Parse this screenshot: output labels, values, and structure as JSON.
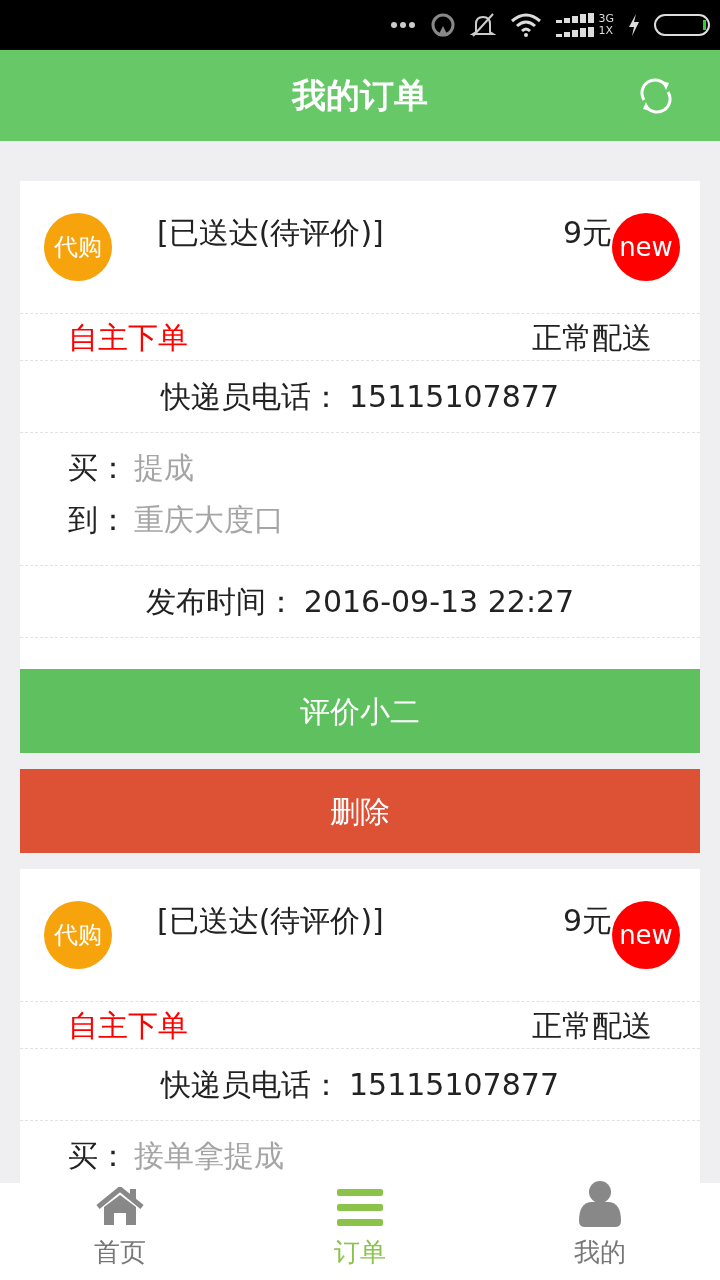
{
  "status_bar": {
    "network_top": "3G",
    "network_bottom": "1X"
  },
  "header": {
    "title": "我的订单"
  },
  "orders": [
    {
      "badge": "代购",
      "status": "[已送达(待评价)]",
      "price": "9元",
      "is_new": true,
      "new_label": "new",
      "source": "自主下单",
      "delivery": "正常配送",
      "courier_label": "快递员电话：",
      "courier_phone": "15115107877",
      "addresses": [
        {
          "label": "买：",
          "value": "提成"
        },
        {
          "label": "到：",
          "value": "重庆大度口"
        }
      ],
      "time_label": "发布时间：",
      "time": "2016-09-13 22:27",
      "actions": [
        {
          "label": "评价小二",
          "kind": "primary"
        },
        {
          "label": "删除",
          "kind": "danger"
        }
      ]
    },
    {
      "badge": "代购",
      "status": "[已送达(待评价)]",
      "price": "9元",
      "is_new": true,
      "new_label": "new",
      "source": "自主下单",
      "delivery": "正常配送",
      "courier_label": "快递员电话：",
      "courier_phone": "15115107877",
      "addresses": [
        {
          "label": "买：",
          "value": "接单拿提成"
        }
      ]
    }
  ],
  "tabs": [
    {
      "label": "首页",
      "selected": false
    },
    {
      "label": "订单",
      "selected": true
    },
    {
      "label": "我的",
      "selected": false
    }
  ]
}
